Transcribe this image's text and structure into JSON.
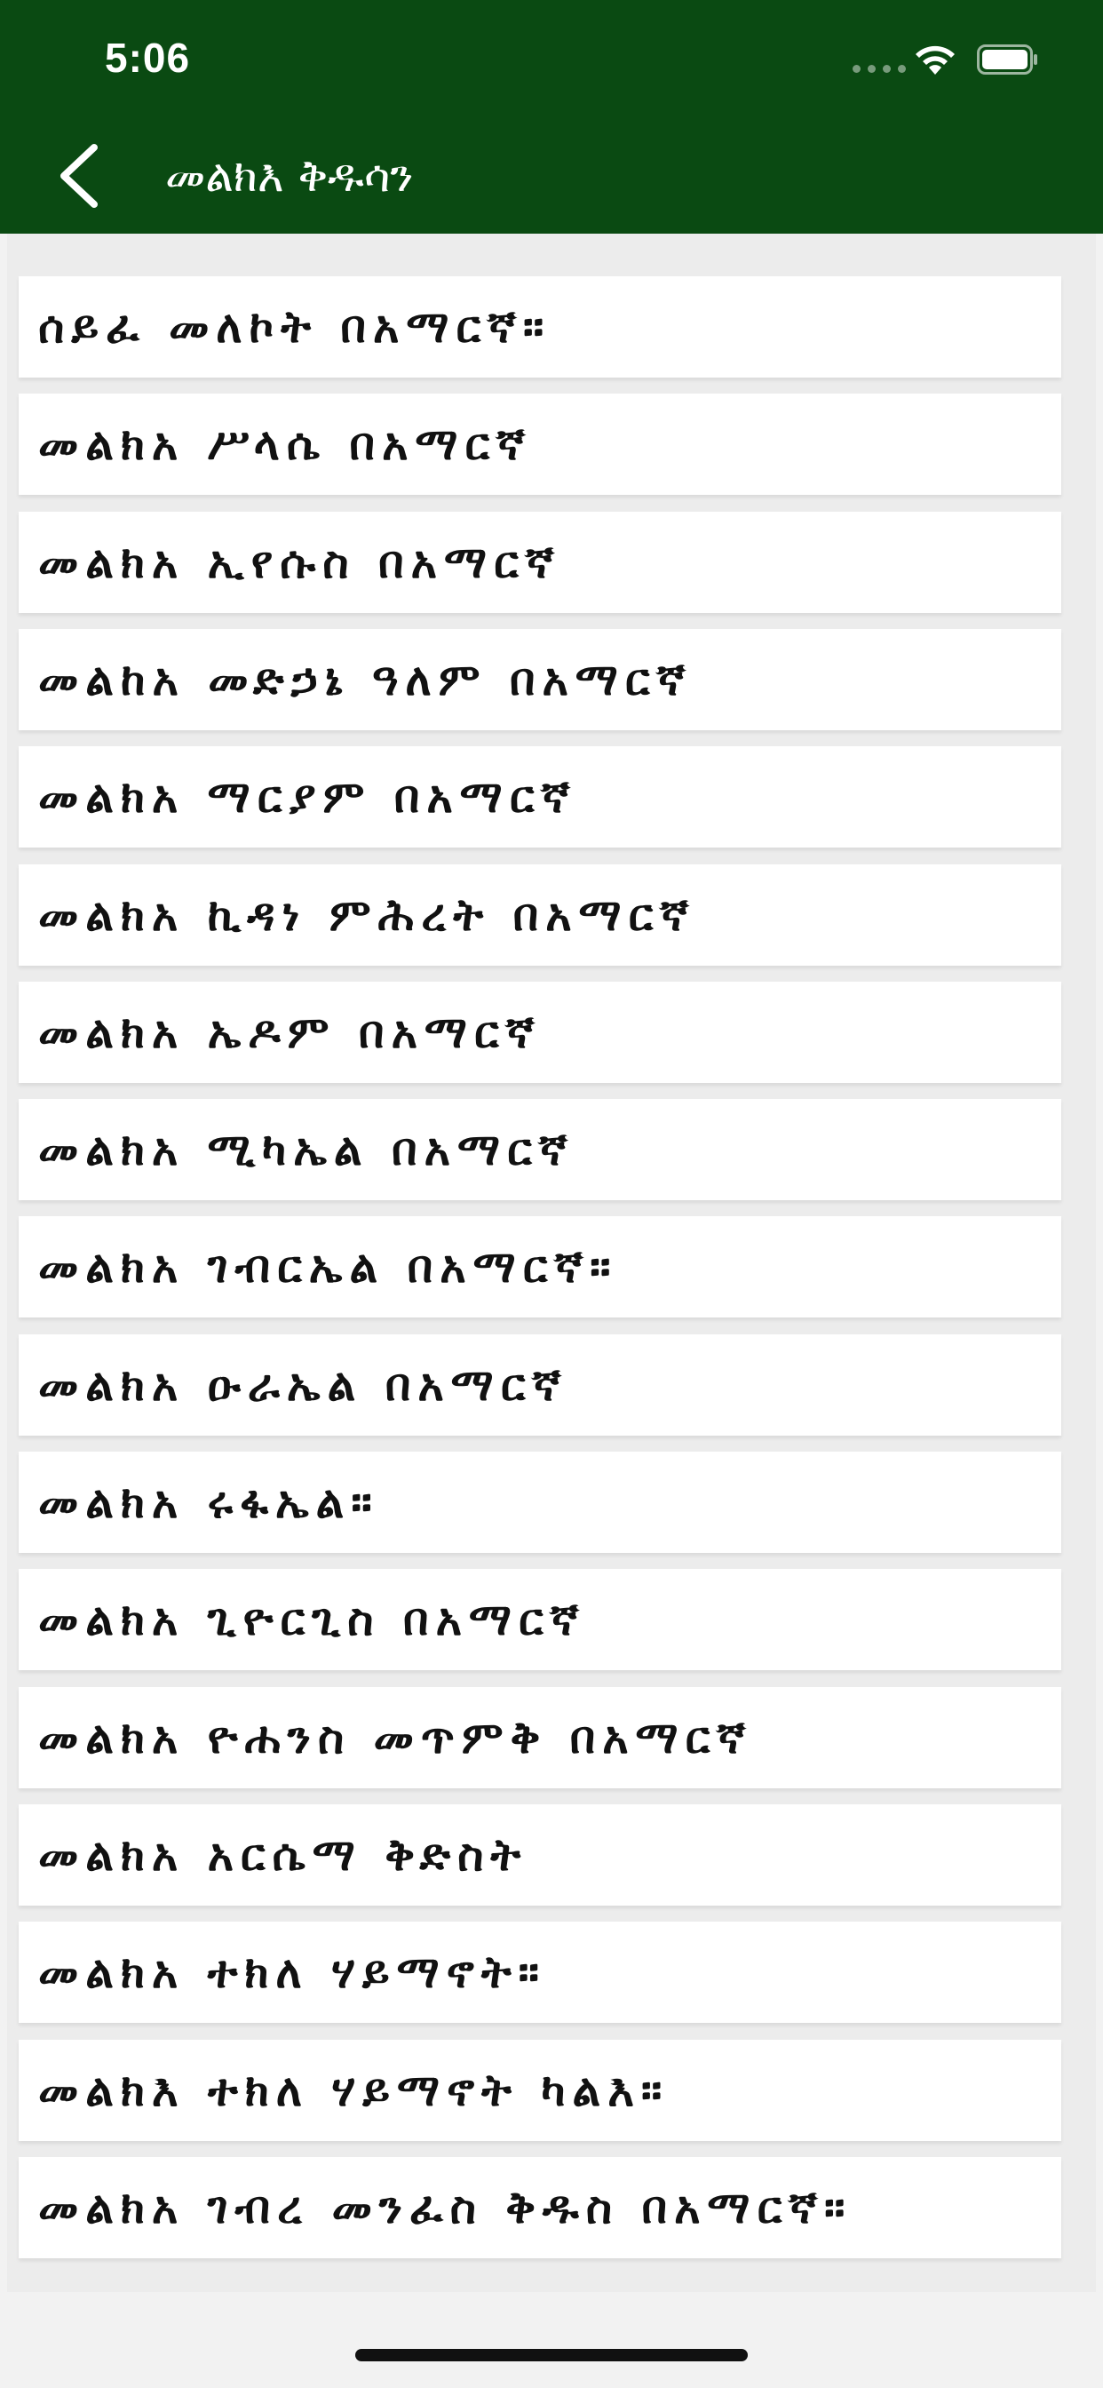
{
  "status_bar": {
    "time": "5:06"
  },
  "nav": {
    "title": "መልክእ ቅዱሳን",
    "back_icon": "chevron-left-icon"
  },
  "colors": {
    "header": "#0a4a12",
    "background": "#f2f2f2",
    "item_text": "#111111"
  },
  "items": [
    {
      "label": "ሰይፈ መለኮት በአማርኛ።"
    },
    {
      "label": "መልክአ ሥላሴ በአማርኛ"
    },
    {
      "label": "መልክአ ኢየሱስ በአማርኛ"
    },
    {
      "label": "መልከአ መድኃኔ ዓለም በአማርኛ"
    },
    {
      "label": "መልክአ ማርያም በአማርኛ"
    },
    {
      "label": "መልክአ ኪዳነ ምሕረት በአማርኛ"
    },
    {
      "label": "መልክአ ኤዶም በአማርኛ"
    },
    {
      "label": "መልክአ ሚካኤል በአማርኛ"
    },
    {
      "label": "መልክአ ገብርኤል በአማርኛ።"
    },
    {
      "label": "መልክአ ዑራኤል በአማርኛ"
    },
    {
      "label": "መልክአ ሩፋኤል።"
    },
    {
      "label": "መልክአ ጊዮርጊስ በአማርኛ"
    },
    {
      "label": "መልክአ ዮሐንስ መጥምቅ በአማርኛ"
    },
    {
      "label": "መልክአ አርሴማ ቅድስት"
    },
    {
      "label": "መልክአ ተክለ ሃይማኖት።"
    },
    {
      "label": "መልክእ ተክለ ሃይማኖት ካልእ።"
    },
    {
      "label": "መልክአ ገብረ መንፈስ ቅዱስ በአማርኛ።"
    }
  ]
}
